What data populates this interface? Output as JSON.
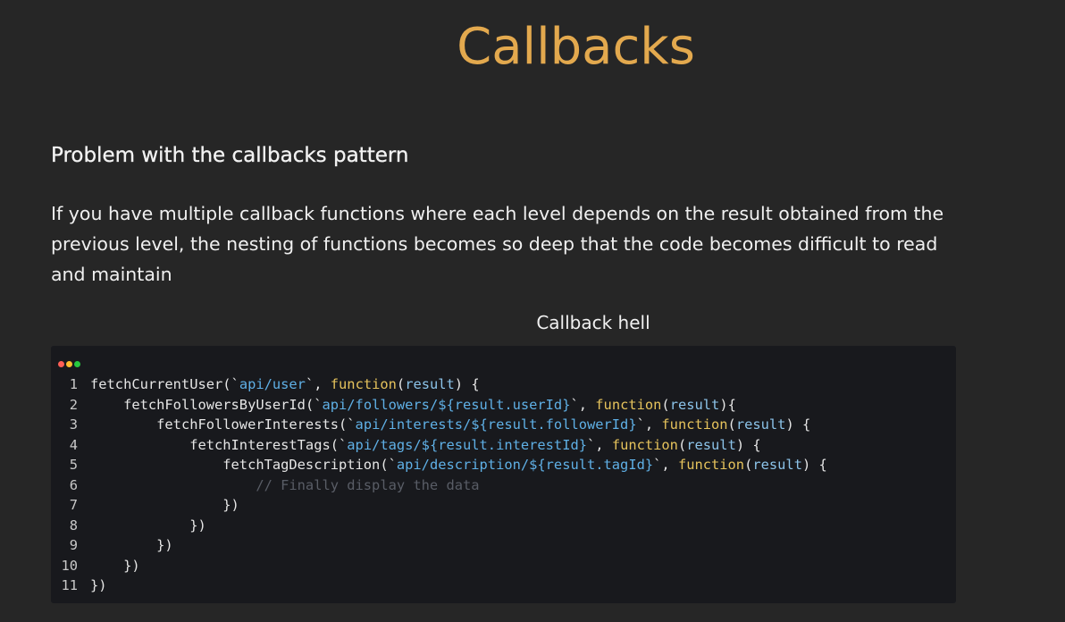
{
  "slide": {
    "title": "Callbacks",
    "subtitle": "Problem with the callbacks pattern",
    "paragraph": "If you have multiple callback functions where each level depends on the result obtained from the previous level, the nesting of functions becomes so deep that the code becomes difficult to read and maintain",
    "caption": "Callback hell"
  },
  "colors": {
    "background": "#262626",
    "title": "#e3a94e",
    "code_background": "#18191d",
    "keyword": "#e6c35c",
    "string": "#5fb0e6",
    "comment": "#595d66"
  },
  "code_window": {
    "dots": [
      "red-dot",
      "yellow-dot",
      "green-dot"
    ],
    "lines": [
      {
        "number": "1",
        "indent": "",
        "tokens": [
          {
            "t": "fn",
            "v": "fetchCurrentUser"
          },
          {
            "t": "pn",
            "v": "(`"
          },
          {
            "t": "str",
            "v": "api/user"
          },
          {
            "t": "pn",
            "v": "`, "
          },
          {
            "t": "kw",
            "v": "function"
          },
          {
            "t": "pn",
            "v": "("
          },
          {
            "t": "param",
            "v": "result"
          },
          {
            "t": "pn",
            "v": ") {"
          }
        ]
      },
      {
        "number": "2",
        "indent": "    ",
        "tokens": [
          {
            "t": "fn",
            "v": "fetchFollowersByUserId"
          },
          {
            "t": "pn",
            "v": "(`"
          },
          {
            "t": "str",
            "v": "api/followers/${result.userId}"
          },
          {
            "t": "pn",
            "v": "`, "
          },
          {
            "t": "kw",
            "v": "function"
          },
          {
            "t": "pn",
            "v": "("
          },
          {
            "t": "param",
            "v": "result"
          },
          {
            "t": "pn",
            "v": "){"
          }
        ]
      },
      {
        "number": "3",
        "indent": "        ",
        "tokens": [
          {
            "t": "fn",
            "v": "fetchFollowerInterests"
          },
          {
            "t": "pn",
            "v": "(`"
          },
          {
            "t": "str",
            "v": "api/interests/${result.followerId}"
          },
          {
            "t": "pn",
            "v": "`, "
          },
          {
            "t": "kw",
            "v": "function"
          },
          {
            "t": "pn",
            "v": "("
          },
          {
            "t": "param",
            "v": "result"
          },
          {
            "t": "pn",
            "v": ") {"
          }
        ]
      },
      {
        "number": "4",
        "indent": "            ",
        "tokens": [
          {
            "t": "fn",
            "v": "fetchInterestTags"
          },
          {
            "t": "pn",
            "v": "(`"
          },
          {
            "t": "str",
            "v": "api/tags/${result.interestId}"
          },
          {
            "t": "pn",
            "v": "`, "
          },
          {
            "t": "kw",
            "v": "function"
          },
          {
            "t": "pn",
            "v": "("
          },
          {
            "t": "param",
            "v": "result"
          },
          {
            "t": "pn",
            "v": ") {"
          }
        ]
      },
      {
        "number": "5",
        "indent": "                ",
        "tokens": [
          {
            "t": "fn",
            "v": "fetchTagDescription"
          },
          {
            "t": "pn",
            "v": "(`"
          },
          {
            "t": "str",
            "v": "api/description/${result.tagId}"
          },
          {
            "t": "pn",
            "v": "`, "
          },
          {
            "t": "kw",
            "v": "function"
          },
          {
            "t": "pn",
            "v": "("
          },
          {
            "t": "param",
            "v": "result"
          },
          {
            "t": "pn",
            "v": ") {"
          }
        ]
      },
      {
        "number": "6",
        "indent": "                    ",
        "tokens": [
          {
            "t": "cm",
            "v": "// Finally display the data"
          }
        ]
      },
      {
        "number": "7",
        "indent": "                ",
        "tokens": [
          {
            "t": "pn",
            "v": "})"
          }
        ]
      },
      {
        "number": "8",
        "indent": "            ",
        "tokens": [
          {
            "t": "pn",
            "v": "})"
          }
        ]
      },
      {
        "number": "9",
        "indent": "        ",
        "tokens": [
          {
            "t": "pn",
            "v": "})"
          }
        ]
      },
      {
        "number": "10",
        "indent": "    ",
        "tokens": [
          {
            "t": "pn",
            "v": "})"
          }
        ]
      },
      {
        "number": "11",
        "indent": "",
        "tokens": [
          {
            "t": "pn",
            "v": "})"
          }
        ]
      }
    ]
  }
}
